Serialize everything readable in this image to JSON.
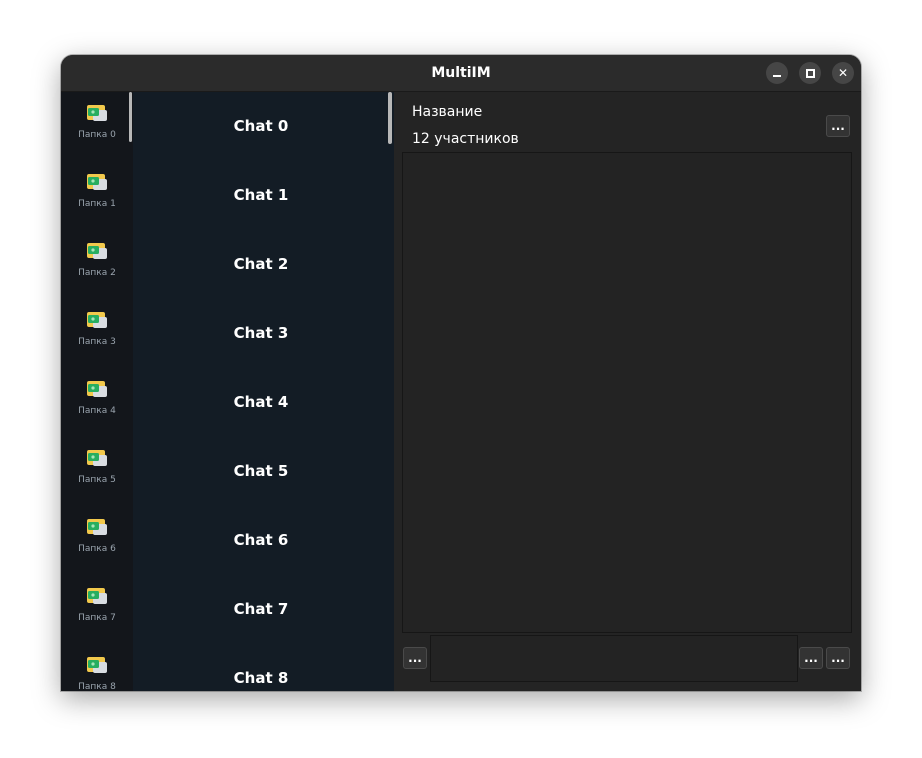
{
  "window": {
    "title": "MultiIM",
    "controls": {
      "minimize_icon": "minimize-icon",
      "maximize_icon": "maximize-icon",
      "close_icon": "close-icon",
      "close_glyph": "✕"
    }
  },
  "folders": [
    {
      "label": "Папка 0",
      "icon": "folder-icon"
    },
    {
      "label": "Папка 1",
      "icon": "folder-icon"
    },
    {
      "label": "Папка 2",
      "icon": "folder-icon"
    },
    {
      "label": "Папка 3",
      "icon": "folder-icon"
    },
    {
      "label": "Папка 4",
      "icon": "folder-icon"
    },
    {
      "label": "Папка 5",
      "icon": "folder-icon"
    },
    {
      "label": "Папка 6",
      "icon": "folder-icon"
    },
    {
      "label": "Папка 7",
      "icon": "folder-icon"
    },
    {
      "label": "Папка 8",
      "icon": "folder-icon"
    }
  ],
  "chats": [
    {
      "label": "Chat 0"
    },
    {
      "label": "Chat 1"
    },
    {
      "label": "Chat 2"
    },
    {
      "label": "Chat 3"
    },
    {
      "label": "Chat 4"
    },
    {
      "label": "Chat 5"
    },
    {
      "label": "Chat 6"
    },
    {
      "label": "Chat 7"
    },
    {
      "label": "Chat 8"
    }
  ],
  "chat_header": {
    "name": "Название",
    "members": "12 участников",
    "menu_label": "..."
  },
  "composer": {
    "attach_label": "...",
    "emoji_label": "...",
    "send_label": "..."
  },
  "colors": {
    "folders_bg": "#13161b",
    "chats_bg": "#131c25",
    "panel_bg": "#242424",
    "titlebar_bg": "#2b2b2b"
  }
}
